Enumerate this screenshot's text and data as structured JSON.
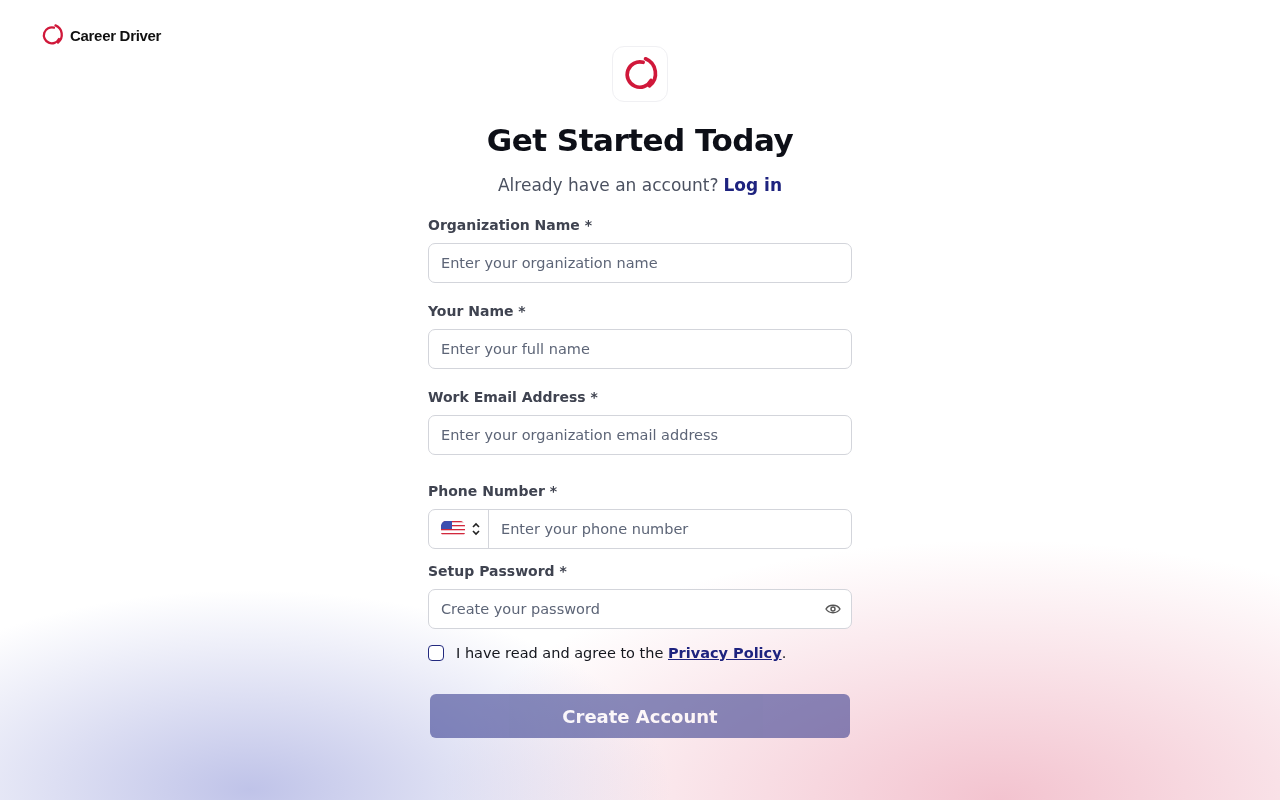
{
  "brand": {
    "name": "Career Driver"
  },
  "heading": "Get Started Today",
  "login_prompt": {
    "text": "Already have an account?",
    "link": "Log in"
  },
  "fields": [
    {
      "kind": "text",
      "label": "Organization Name *",
      "placeholder": "Enter your organization name"
    },
    {
      "kind": "text",
      "label": "Your Name *",
      "placeholder": "Enter your full name"
    },
    {
      "kind": "text",
      "label": "Work Email Address *",
      "placeholder": "Enter your organization email address"
    },
    {
      "kind": "phone",
      "label": "Phone Number *",
      "placeholder": "Enter your phone number"
    },
    {
      "kind": "password",
      "label": "Setup Password *",
      "placeholder": "Create your password"
    }
  ],
  "consent": {
    "checked": false,
    "text": "I have read and agree to the ",
    "link": "Privacy Policy",
    "after": "."
  },
  "submit": {
    "label": "Create Account",
    "disabled": true
  }
}
